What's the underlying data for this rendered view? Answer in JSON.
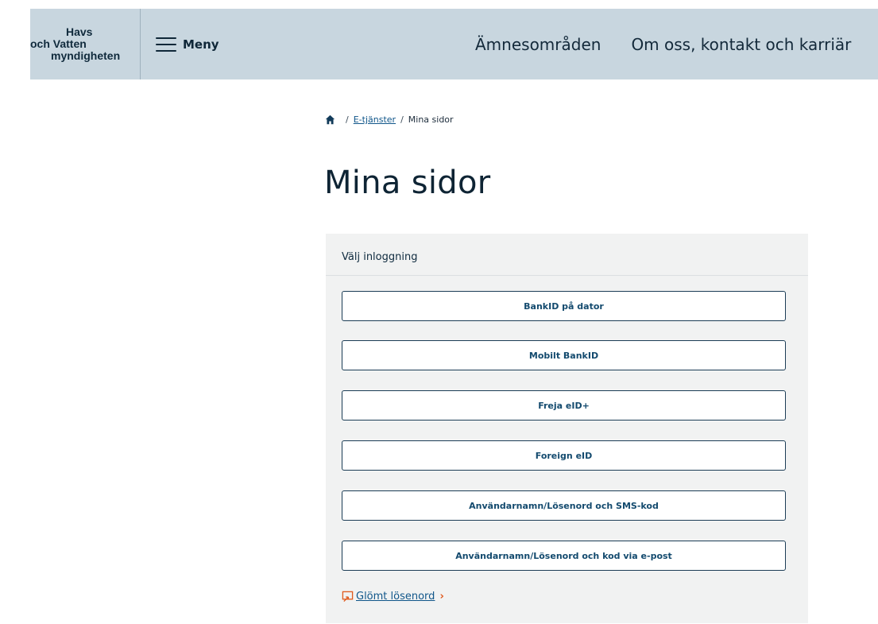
{
  "header": {
    "logo": {
      "line1": "Havs",
      "line2": "och Vatten",
      "line3": "myndigheten"
    },
    "menu_label": "Meny",
    "nav": [
      "Ämnesområden",
      "Om oss, kontakt och karriär"
    ]
  },
  "breadcrumb": {
    "sep": "/",
    "link": "E-tjänster",
    "current": "Mina sidor"
  },
  "page": {
    "title": "Mina sidor"
  },
  "login": {
    "heading": "Välj inloggning",
    "options": [
      "BankID på dator",
      "Mobilt BankID",
      "Freja eID+",
      "Foreign eID",
      "Användarnamn/Lösenord och SMS-kod",
      "Användarnamn/Lösenord och kod via e-post"
    ],
    "forgot_label": "Glömt lösenord",
    "forgot_chevron": "›"
  },
  "colors": {
    "header_bg": "#c8d6df",
    "card_bg": "#f1f2f2",
    "link": "#10568a",
    "accent": "#e05a1e"
  }
}
